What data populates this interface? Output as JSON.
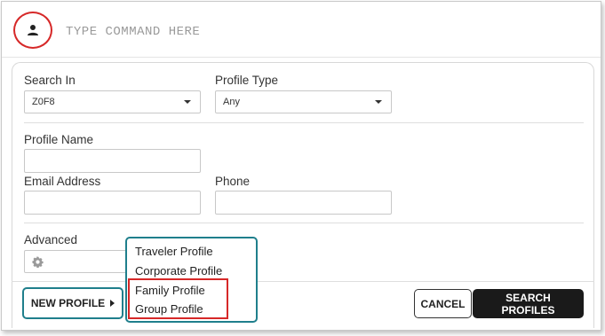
{
  "command_bar": {
    "placeholder": "TYPE COMMAND HERE",
    "avatar_icon": "person-icon",
    "highlight_color": "#d62828"
  },
  "search_form": {
    "search_in": {
      "label": "Search In",
      "value": "Z0F8"
    },
    "profile_type": {
      "label": "Profile Type",
      "value": "Any"
    },
    "profile_name": {
      "label": "Profile Name",
      "value": ""
    },
    "email_address": {
      "label": "Email Address",
      "value": ""
    },
    "phone": {
      "label": "Phone",
      "value": ""
    },
    "advanced": {
      "label": "Advanced",
      "icon": "gear-icon"
    }
  },
  "footer": {
    "new_profile_label": "NEW PROFILE",
    "cancel_label": "CANCEL",
    "search_label": "SEARCH PROFILES"
  },
  "new_profile_menu": {
    "items": [
      "Traveler Profile",
      "Corporate Profile",
      "Family Profile",
      "Group Profile"
    ],
    "accent_color": "#1f7f8c"
  }
}
